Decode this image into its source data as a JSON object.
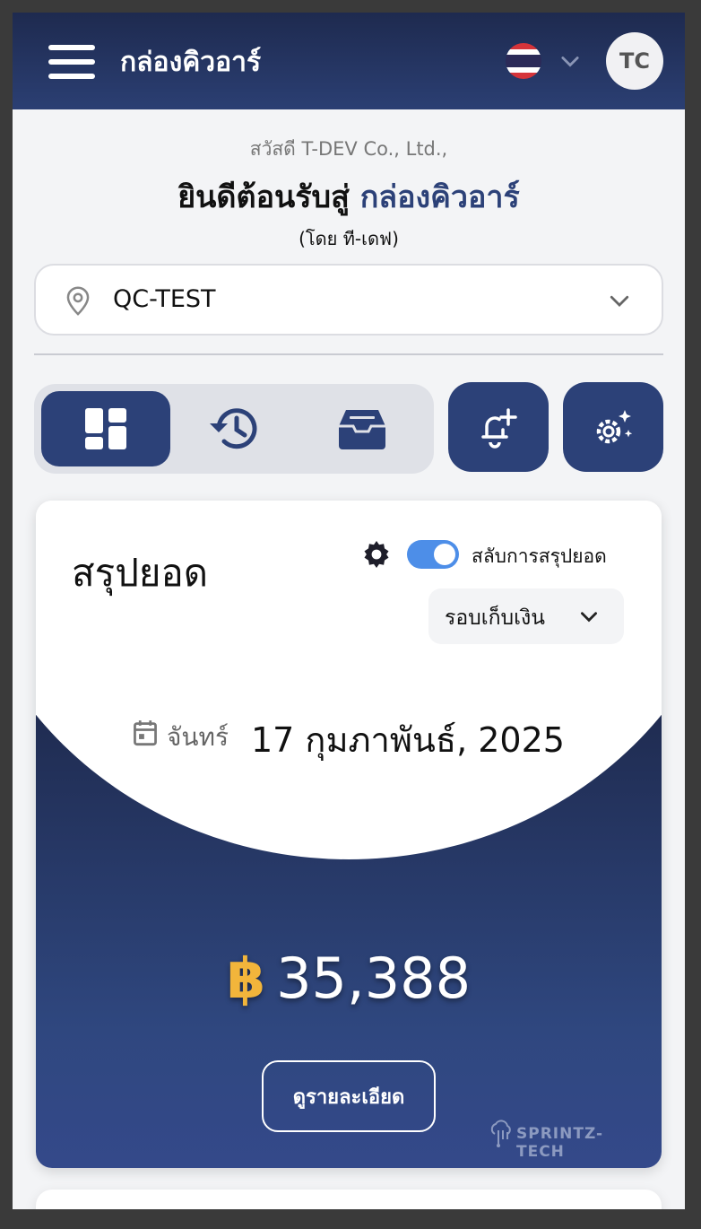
{
  "header": {
    "menu_icon": "hamburger-menu-icon",
    "app_title": "กล่องคิวอาร์",
    "language": "TH",
    "avatar_initials": "TC"
  },
  "welcome": {
    "greeting": "สวัสดี T-DEV Co., Ltd.,",
    "title_prefix": "ยินดีต้อนรับสู่",
    "title_brand": "กล่องคิวอาร์",
    "byline": "(โดย ที-เดฟ)"
  },
  "branch": {
    "selected": "QC-TEST"
  },
  "tabs": [
    {
      "icon": "dashboard-icon",
      "active": true
    },
    {
      "icon": "history-icon",
      "active": false
    },
    {
      "icon": "inbox-icon",
      "active": false
    }
  ],
  "actions": [
    {
      "icon": "bell-plus-icon"
    },
    {
      "icon": "gear-sparkle-icon"
    }
  ],
  "summary": {
    "title": "สรุปยอด",
    "toggle_label": "สลับการสรุปยอด",
    "toggle_on": true,
    "cycle_label": "รอบเก็บเงิน",
    "day": "จันทร์",
    "date": "17  กุมภาพันธ์, 2025",
    "currency": "฿",
    "amount": "35,388",
    "detail_button": "ดูรายละเอียด",
    "logo_text": "SPRINTZ-TECH"
  },
  "colors": {
    "primary": "#2c4178",
    "accent": "#f2b53b",
    "toggle": "#4d8ee8"
  }
}
